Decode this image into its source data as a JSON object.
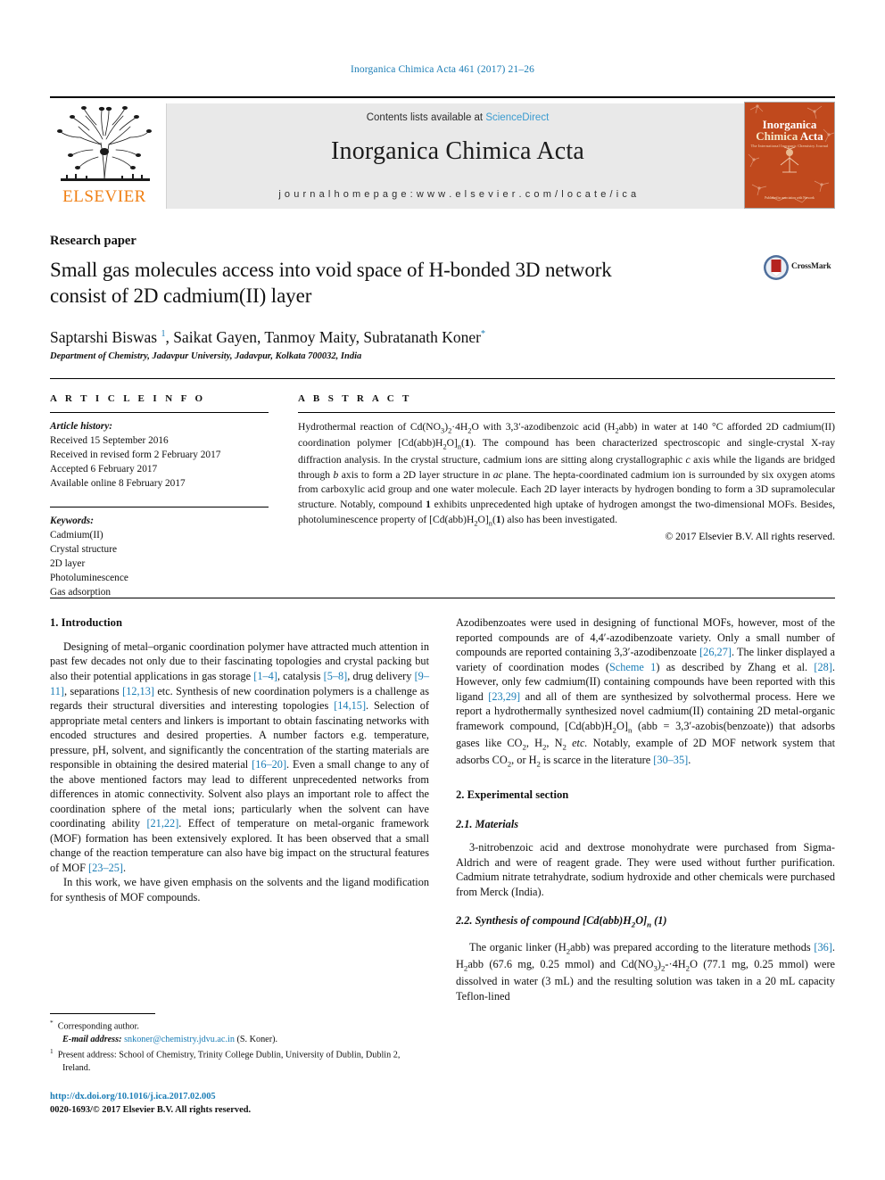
{
  "running_head": "Inorganica Chimica Acta 461 (2017) 21–26",
  "masthead": {
    "publisher": "ELSEVIER",
    "contents_prefix": "Contents lists available at ",
    "contents_link": "ScienceDirect",
    "journal_title": "Inorganica Chimica Acta",
    "homepage": "j o u r n a l   h o m e p a g e :   w w w . e l s e v i e r . c o m / l o c a t e / i c a",
    "cover": {
      "line1": "Inorganica",
      "line2_word1": "Chimica",
      "line2_word2": "Acta",
      "subtitle": "The International Inorganic Chemistry Journal",
      "footer": "Published in association with\nNetwork"
    },
    "accent_color": "#3a9bd0",
    "band_color": "#e9e9e9",
    "cover_color": "#c0491d",
    "elsevier_orange": "#f07f13"
  },
  "article": {
    "kicker": "Research paper",
    "title_line1": "Small gas molecules access into void space of H-bonded 3D network",
    "title_line2": "consist of 2D cadmium(II) layer",
    "crossmark_label": "CrossMark",
    "authors_html": "Saptarshi Biswas <sup class=\"sup-blue\">1</sup>, Saikat Gayen, Tanmoy Maity, Subratanath Koner<sup class=\"sup-blue\">*</sup>",
    "affiliation": "Department of Chemistry, Jadavpur University, Jadavpur, Kolkata 700032, India"
  },
  "article_info": {
    "heading": "A R T I C L E  I N F O",
    "history_label": "Article history:",
    "history": [
      "Received 15 September 2016",
      "Received in revised form 2 February 2017",
      "Accepted 6 February 2017",
      "Available online 8 February 2017"
    ],
    "keywords_label": "Keywords:",
    "keywords": [
      "Cadmium(II)",
      "Crystal structure",
      "2D layer",
      "Photoluminescence",
      "Gas adsorption"
    ]
  },
  "abstract": {
    "heading": "A B S T R A C T",
    "text_html": "Hydrothermal reaction of Cd(NO<sub>3</sub>)<sub>2</sub>·4H<sub>2</sub>O with 3,3&prime;-azodibenzoic acid (H<sub>2</sub>abb) in water at 140 &deg;C afforded 2D cadmium(II) coordination polymer [Cd(abb)H<sub>2</sub>O]<sub>n</sub>(<b>1</b>). The compound has been characterized spectroscopic and single-crystal X-ray diffraction analysis. In the crystal structure, cadmium ions are sitting along crystallographic <i>c</i> axis while the ligands are bridged through <i>b</i> axis to form a 2D layer structure in <i>ac</i> plane. The hepta-coordinated cadmium ion is surrounded by six oxygen atoms from carboxylic acid group and one water molecule. Each 2D layer interacts by hydrogen bonding to form a 3D supramolecular structure. Notably, compound <b>1</b> exhibits unprecedented high uptake of hydrogen amongst the two-dimensional MOFs. Besides, photoluminescence property of [Cd(abb)H<sub>2</sub>O]<sub>n</sub>(<b>1</b>) also has been investigated.",
    "copyright": "&copy; 2017 Elsevier B.V. All rights reserved."
  },
  "sections": {
    "introduction_heading": "1. Introduction",
    "intro_p1_html": "Designing of metal&ndash;organic coordination polymer have attracted much attention in past few decades not only due to their fascinating topologies and crystal packing but also their potential applications in gas storage <span class=\"ref\">[1&ndash;4]</span>, catalysis <span class=\"ref\">[5&ndash;8]</span>, drug delivery <span class=\"ref\">[9&ndash;11]</span>, separations <span class=\"ref\">[12,13]</span> etc. Synthesis of new coordination polymers is a challenge as regards their structural diversities and interesting topologies <span class=\"ref\">[14,15]</span>. Selection of appropriate metal centers and linkers is important to obtain fascinating networks with encoded structures and desired properties. A number factors e.g. temperature, pressure, pH, solvent, and significantly the concentration of the starting materials are responsible in obtaining the desired material <span class=\"ref\">[16&ndash;20]</span>. Even a small change to any of the above mentioned factors may lead to different unprecedented networks from differences in atomic connectivity. Solvent also plays an important role to affect the coordination sphere of the metal ions; particularly when the solvent can have coordinating ability <span class=\"ref\">[21,22]</span>. Effect of temperature on metal-organic framework (MOF) formation has been extensively explored. It has been observed that a small change of the reaction temperature can also have big impact on the structural features of MOF <span class=\"ref\">[23&ndash;25]</span>.",
    "intro_p2_html": "In this work, we have given emphasis on the solvents and the ligand modification for synthesis of MOF compounds.",
    "intro_p3_html": "Azodibenzoates were used in designing of functional MOFs, however, most of the reported compounds are of 4,4&prime;-azodibenzoate variety. Only a small number of compounds are reported containing 3,3&prime;-azodibenzoate <span class=\"ref\">[26,27]</span>. The linker displayed a variety of coordination modes (<span class=\"link\">Scheme 1</span>) as described by Zhang et al. <span class=\"ref\">[28]</span>. However, only few cadmium(II) containing compounds have been reported with this ligand <span class=\"ref\">[23,29]</span> and all of them are synthesized by solvothermal process. Here we report a hydrothermally synthesized novel cadmium(II) containing 2D metal-organic framework compound, [Cd(abb)H<sub>2</sub>O]<sub>n</sub> (abb = 3,3&prime;-azobis(benzoate)) that adsorbs gases like CO<sub>2</sub>, H<sub>2</sub>, N<sub>2</sub> <i>etc.</i> Notably, example of 2D MOF network system that adsorbs CO<sub>2</sub>, or H<sub>2</sub> is scarce in the literature <span class=\"ref\">[30&ndash;35]</span>.",
    "experimental_heading": "2. Experimental section",
    "materials_heading": "2.1. Materials",
    "materials_p_html": "3-nitrobenzoic acid and dextrose monohydrate were purchased from Sigma-Aldrich and were of reagent grade. They were used without further purification. Cadmium nitrate tetrahydrate, sodium hydroxide and other chemicals were purchased from Merck (India).",
    "synthesis_heading_html": "2.2. Synthesis of compound [Cd(abb)H<sub>2</sub>O]<sub>n</sub> (1)",
    "synthesis_p_html": "The organic linker (H<sub>2</sub>abb) was prepared according to the literature methods <span class=\"ref\">[36]</span>. H<sub>2</sub>abb (67.6 mg, 0.25 mmol) and Cd(NO<sub>3</sub>)<sub>2</sub>-&middot;4H<sub>2</sub>O (77.1 mg, 0.25 mmol) were dissolved in water (3 mL) and the resulting solution was taken in a 20 mL capacity Teflon-lined"
  },
  "footnotes": {
    "corresponding_html": "<sup>*</sup>&nbsp; Corresponding author.",
    "email_html": "<span class=\"em\">E-mail address:</span> <span class=\"link\">snkoner@chemistry.jdvu.ac.in</span> (S. Koner).",
    "present_address_html": "<sup>1</sup>&nbsp; Present address: School of Chemistry, Trinity College Dublin, University of Dublin, Dublin 2, Ireland."
  },
  "footer": {
    "doi": "http://dx.doi.org/10.1016/j.ica.2017.02.005",
    "issn_line": "0020-1693/&copy; 2017 Elsevier B.V. All rights reserved."
  }
}
